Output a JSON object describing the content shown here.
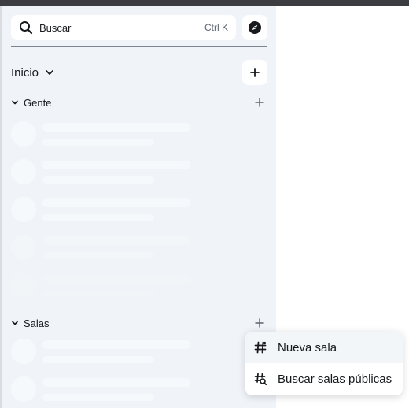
{
  "search": {
    "placeholder": "Buscar",
    "shortcut": "Ctrl K",
    "icon": "search-icon"
  },
  "explore": {
    "icon": "compass-icon"
  },
  "home": {
    "title": "Inicio",
    "menu_icon": "chevron-down-icon",
    "add_icon": "plus-icon"
  },
  "sections": {
    "people": {
      "label": "Gente",
      "icon": "chevron-down-icon",
      "add_icon": "plus-icon"
    },
    "rooms": {
      "label": "Salas",
      "icon": "chevron-down-icon",
      "add_icon": "plus-icon"
    }
  },
  "context_menu": {
    "items": [
      {
        "label": "Nueva sala",
        "icon": "hash-icon"
      },
      {
        "label": "Buscar salas públicas",
        "icon": "hash-search-icon"
      }
    ]
  },
  "colors": {
    "sidebar_bg": "#f0f4f8",
    "text": "#17191c",
    "skeleton": "#f6f9fb"
  }
}
